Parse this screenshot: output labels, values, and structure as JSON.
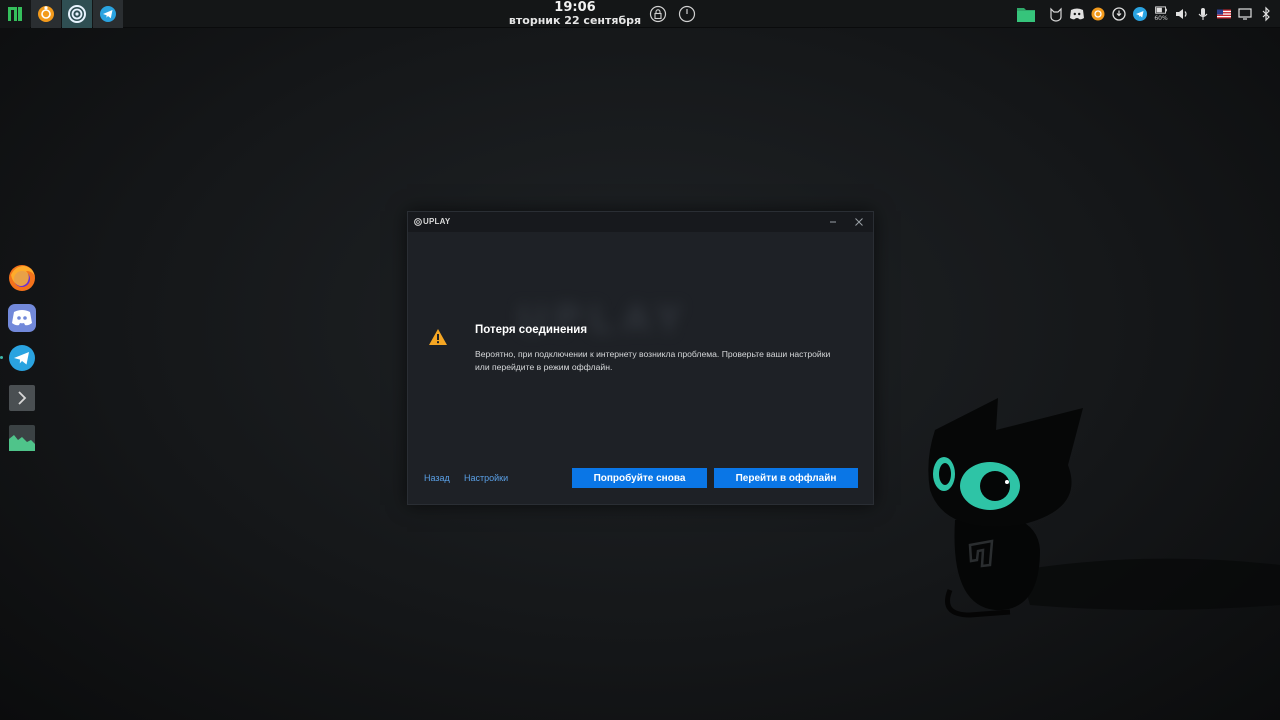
{
  "taskbar": {
    "apps": [
      {
        "name": "manjaro-menu",
        "icon": "manjaro-logo-icon",
        "active": false
      },
      {
        "name": "ubuntu-app",
        "icon": "ubuntu-icon",
        "active": false
      },
      {
        "name": "uplay",
        "icon": "uplay-icon",
        "active": true
      },
      {
        "name": "telegram",
        "icon": "telegram-icon",
        "active": false
      }
    ],
    "clock": {
      "time": "19:06",
      "date": "вторник 22 сентября"
    },
    "tray": {
      "battery_label": "60%"
    }
  },
  "dock": {
    "items": [
      "firefox-icon",
      "discord-icon",
      "telegram-icon",
      "terminal-icon",
      "system-monitor-icon"
    ]
  },
  "dialog": {
    "app_name": "UPLAY",
    "title": "Потеря соединения",
    "body": "Вероятно, при подключении к интернету возникла проблема. Проверьте ваши настройки или перейдите в режим оффлайн.",
    "link_back": "Назад",
    "link_settings": "Настройки",
    "button_retry": "Попробуйте снова",
    "button_offline": "Перейти в оффлайн",
    "accent_color": "#0a76e6"
  },
  "colors": {
    "accent": "#0a76e6",
    "manjaro_green": "#35bf5c",
    "mascot_eye": "#2ec4a6"
  }
}
